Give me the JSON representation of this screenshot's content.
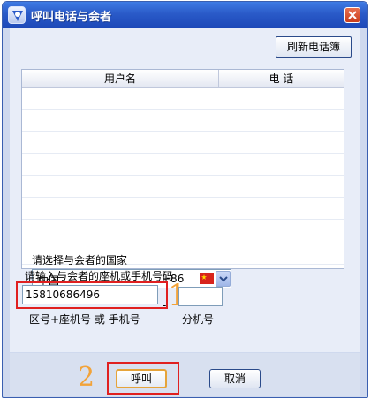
{
  "window": {
    "title": "呼叫电话与会者",
    "app_icon": "app-logo-icon",
    "close_icon": "close-icon"
  },
  "toolbar": {
    "refresh_label": "刷新电话簿"
  },
  "list": {
    "columns": [
      "用户名",
      "电 话"
    ],
    "rows": []
  },
  "country": {
    "label": "请选择与会者的国家",
    "selected_name": "中国",
    "selected_code": "+86",
    "flag_icon": "china-flag-icon"
  },
  "phone": {
    "label": "请输入与会者的座机或手机号码",
    "value": "15810686496",
    "separator": "-",
    "ext_value": "",
    "hint_main": "区号+座机号 或 手机号",
    "hint_ext": "分机号"
  },
  "annotations": {
    "step1": "1",
    "step2": "2",
    "color": "#f2a33a",
    "highlight_color": "#e02020"
  },
  "actions": {
    "call_label": "呼叫",
    "cancel_label": "取消"
  }
}
